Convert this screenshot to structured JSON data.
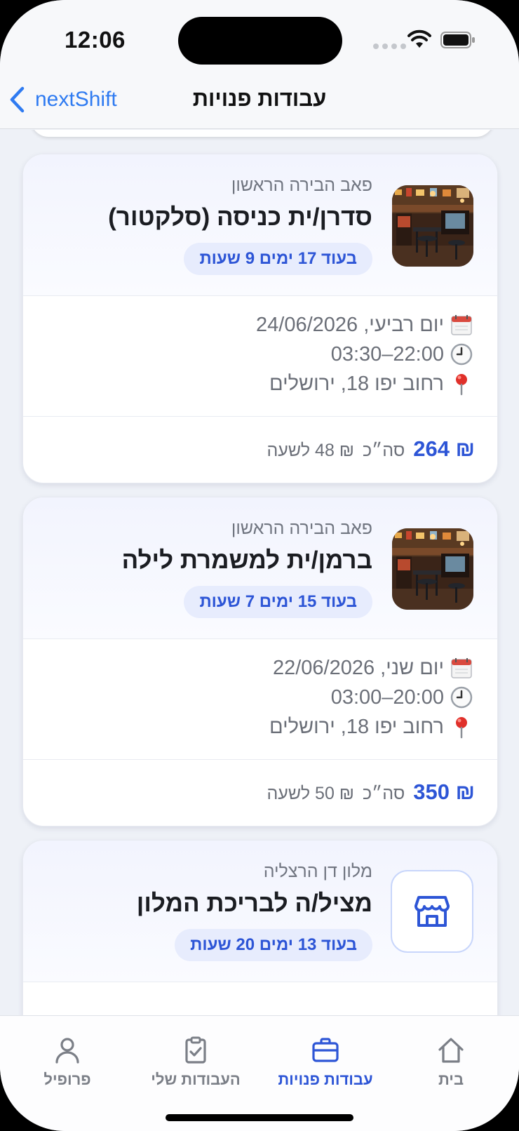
{
  "status_bar": {
    "time": "12:06"
  },
  "nav": {
    "back_label": "nextShift",
    "title": "עבודות פנויות"
  },
  "jobs": [
    {
      "employer": "פאב הבירה הראשון",
      "title": "סדרן/ית כניסה (סלקטור)",
      "countdown": "בעוד 17 ימים 9 שעות",
      "thumbnail": "bar-photo",
      "date": "יום רביעי, 24/06/2026",
      "hours": "22:00–03:30",
      "address": "רחוב יפו 18, ירושלים",
      "total": "₪ 264",
      "total_label": "סה״כ",
      "rate": "₪ 48 לשעה"
    },
    {
      "employer": "פאב הבירה הראשון",
      "title": "ברמן/ית למשמרת לילה",
      "countdown": "בעוד 15 ימים 7 שעות",
      "thumbnail": "bar-photo",
      "date": "יום שני, 22/06/2026",
      "hours": "20:00–03:00",
      "address": "רחוב יפו 18, ירושלים",
      "total": "₪ 350",
      "total_label": "סה״כ",
      "rate": "₪ 50 לשעה"
    },
    {
      "employer": "מלון דן הרצליה",
      "title": "מציל/ה לבריכת המלון",
      "countdown": "בעוד 13 ימים 20 שעות",
      "thumbnail": "store-icon"
    }
  ],
  "tabs": [
    {
      "label": "בית",
      "icon": "home-icon",
      "active": false
    },
    {
      "label": "עבודות פנויות",
      "icon": "briefcase-icon",
      "active": true
    },
    {
      "label": "העבודות שלי",
      "icon": "clipboard-check-icon",
      "active": false
    },
    {
      "label": "פרופיל",
      "icon": "person-icon",
      "active": false
    }
  ],
  "colors": {
    "accent": "#2d55d6",
    "link": "#2f7bf1",
    "background": "#eef1f7"
  }
}
